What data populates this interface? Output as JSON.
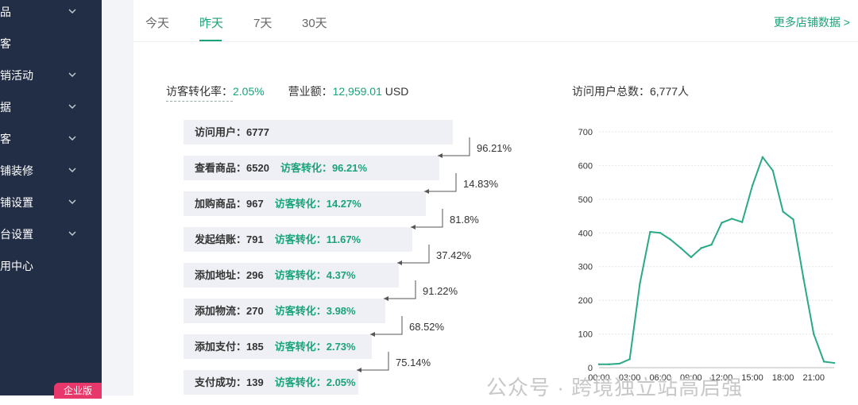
{
  "sidebar": {
    "items": [
      {
        "label": "品",
        "has_chevron": true
      },
      {
        "label": "客",
        "has_chevron": false
      },
      {
        "label": "销活动",
        "has_chevron": true
      },
      {
        "label": "据",
        "has_chevron": true
      },
      {
        "label": "客",
        "has_chevron": true
      },
      {
        "label": "铺装修",
        "has_chevron": true
      },
      {
        "label": "铺设置",
        "has_chevron": true
      },
      {
        "label": "台设置",
        "has_chevron": true
      },
      {
        "label": "用中心",
        "has_chevron": false
      }
    ],
    "badge": "企业版"
  },
  "tabs": {
    "items": [
      "今天",
      "昨天",
      "7天",
      "30天"
    ],
    "active": "昨天",
    "more_link": "更多店铺数据 >"
  },
  "summary": {
    "conversion_label": "访客转化率：",
    "conversion_value": "2.05%",
    "revenue_label": "营业额：",
    "revenue_value": "12,959.01",
    "revenue_unit": "USD",
    "total_visitors_label": "访问用户总数：",
    "total_visitors_value": "6,777人"
  },
  "funnel": {
    "conv_label": "访客转化：",
    "steps": [
      {
        "label": "访问用户：",
        "count": "6777",
        "conv": ""
      },
      {
        "label": "查看商品：",
        "count": "6520",
        "conv": "96.21%"
      },
      {
        "label": "加购商品：",
        "count": "967",
        "conv": "14.27%"
      },
      {
        "label": "发起结账：",
        "count": "791",
        "conv": "11.67%"
      },
      {
        "label": "添加地址：",
        "count": "296",
        "conv": "4.37%"
      },
      {
        "label": "添加物流：",
        "count": "270",
        "conv": "3.98%"
      },
      {
        "label": "添加支付：",
        "count": "185",
        "conv": "2.73%"
      },
      {
        "label": "支付成功：",
        "count": "139",
        "conv": "2.05%"
      }
    ],
    "step_rates": [
      "96.21%",
      "14.83%",
      "81.8%",
      "37.42%",
      "91.22%",
      "68.52%",
      "75.14%"
    ]
  },
  "chart_data": {
    "type": "line",
    "x": [
      "00:00",
      "01:00",
      "02:00",
      "03:00",
      "04:00",
      "05:00",
      "06:00",
      "07:00",
      "08:00",
      "09:00",
      "10:00",
      "11:00",
      "12:00",
      "13:00",
      "14:00",
      "15:00",
      "16:00",
      "17:00",
      "18:00",
      "19:00",
      "20:00",
      "21:00",
      "22:00",
      "23:00"
    ],
    "x_tick_labels": [
      "00:00",
      "03:00",
      "06:00",
      "09:00",
      "12:00",
      "15:00",
      "18:00",
      "21:00"
    ],
    "values": [
      10,
      10,
      12,
      25,
      250,
      403,
      400,
      380,
      355,
      328,
      355,
      365,
      430,
      442,
      432,
      540,
      625,
      585,
      463,
      440,
      265,
      100,
      18,
      14
    ],
    "ylim": [
      0,
      700
    ],
    "yticks": [
      0,
      100,
      200,
      300,
      400,
      500,
      600,
      700
    ],
    "color": "#2aa987",
    "grid": true
  },
  "watermark": "公众号 · 跨境独立站高启强"
}
